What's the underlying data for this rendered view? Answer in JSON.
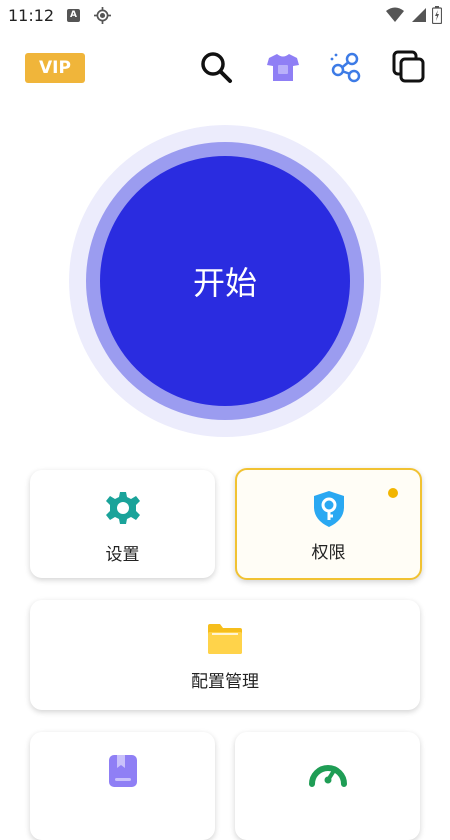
{
  "status_bar": {
    "time": "11:12",
    "a_icon_letter": "A"
  },
  "toolbar": {
    "vip_label": "VIP"
  },
  "start_button": {
    "label": "开始"
  },
  "cards": {
    "settings": {
      "label": "设置"
    },
    "permissions": {
      "label": "权限"
    },
    "config": {
      "label": "配置管理"
    },
    "bottom_left": {
      "label": ""
    },
    "bottom_right": {
      "label": ""
    }
  },
  "colors": {
    "vip": "#f0b53a",
    "start_blue": "#2a2ce0",
    "settings_icon": "#1aa39a",
    "permission_icon": "#2aa8f2",
    "folder": "#f6be1c",
    "highlight_border": "#f1c232",
    "bottom_left_icon": "#8f7ff5",
    "speed_icon": "#1f9d55"
  }
}
